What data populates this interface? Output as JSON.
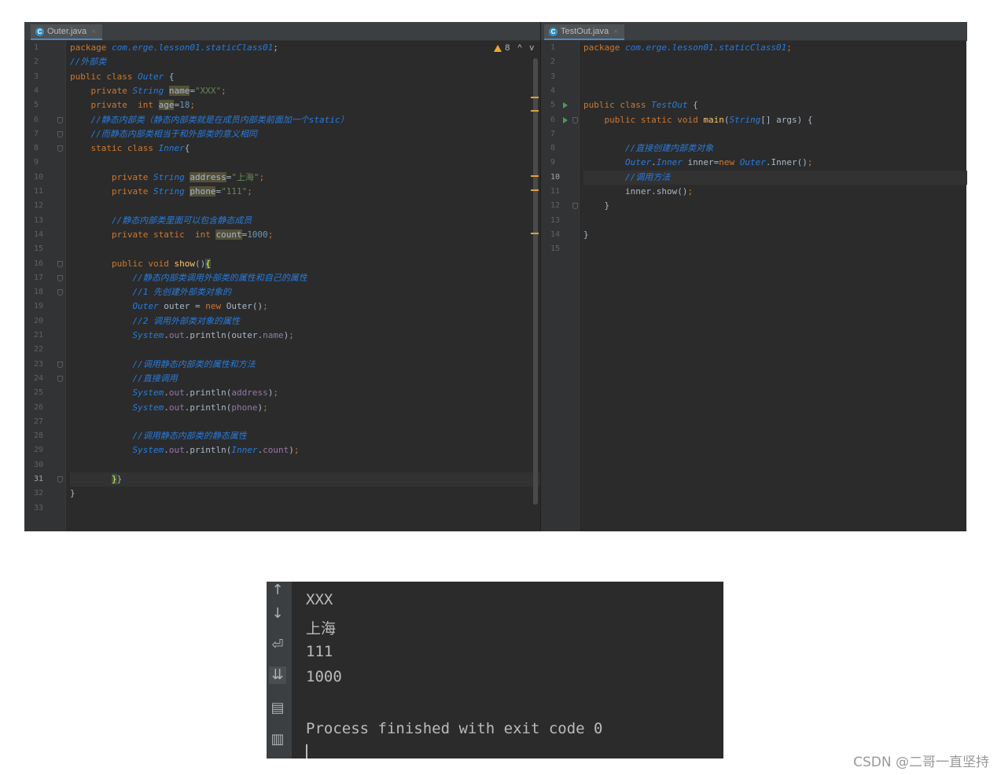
{
  "left_tab": {
    "label": "Outer.java",
    "close": "×"
  },
  "right_tab": {
    "label": "TestOut.java",
    "close": "×"
  },
  "inspection": {
    "count": "8",
    "up": "^",
    "down": "v"
  },
  "left_lines": [
    [
      [
        "kw",
        "package "
      ],
      [
        "ty",
        "com.erge.lesson01.staticClass01"
      ],
      [
        "",
        "; "
      ]
    ],
    [
      [
        "cm",
        "//外部类"
      ]
    ],
    [
      [
        "kw",
        "public class "
      ],
      [
        "cls",
        "Outer"
      ],
      [
        "",
        " {"
      ]
    ],
    [
      [
        "",
        "    "
      ],
      [
        "kw",
        "private "
      ],
      [
        "ty",
        "String "
      ],
      [
        "hl",
        "name"
      ],
      [
        "",
        "="
      ],
      [
        "str",
        "\"XXX\""
      ],
      [
        "kw",
        ";"
      ]
    ],
    [
      [
        "",
        "    "
      ],
      [
        "kw",
        "private  int "
      ],
      [
        "hl",
        "age"
      ],
      [
        "",
        "="
      ],
      [
        "num",
        "18"
      ],
      [
        "kw",
        ";"
      ]
    ],
    [
      [
        "",
        "    "
      ],
      [
        "cm",
        "//静态内部类（静态内部类就是在成员内部类前面加一个static）"
      ]
    ],
    [
      [
        "",
        "    "
      ],
      [
        "cm",
        "//而静态内部类相当于和外部类的意义相同"
      ]
    ],
    [
      [
        "",
        "    "
      ],
      [
        "kw",
        "static class "
      ],
      [
        "cls",
        "Inner"
      ],
      [
        "",
        "{"
      ]
    ],
    [
      [
        "",
        ""
      ]
    ],
    [
      [
        "",
        "        "
      ],
      [
        "kw",
        "private "
      ],
      [
        "ty",
        "String "
      ],
      [
        "hl",
        "address"
      ],
      [
        "",
        "="
      ],
      [
        "str",
        "\"上海\""
      ],
      [
        "kw",
        ";"
      ]
    ],
    [
      [
        "",
        "        "
      ],
      [
        "kw",
        "private "
      ],
      [
        "ty",
        "String "
      ],
      [
        "hl",
        "phone"
      ],
      [
        "",
        "="
      ],
      [
        "str",
        "\"111\""
      ],
      [
        "kw",
        ";"
      ]
    ],
    [
      [
        "",
        ""
      ]
    ],
    [
      [
        "",
        "        "
      ],
      [
        "cm",
        "//静态内部类里面可以包含静态成员"
      ]
    ],
    [
      [
        "",
        "        "
      ],
      [
        "kw",
        "private static  int "
      ],
      [
        "hl",
        "count"
      ],
      [
        "",
        "="
      ],
      [
        "num",
        "1000"
      ],
      [
        "kw",
        ";"
      ]
    ],
    [
      [
        "",
        ""
      ]
    ],
    [
      [
        "",
        "        "
      ],
      [
        "kw",
        "public void "
      ],
      [
        "fn",
        "show"
      ],
      [
        "",
        "()"
      ],
      [
        "brk",
        "{"
      ]
    ],
    [
      [
        "",
        "            "
      ],
      [
        "cm",
        "//静态内部类调用外部类的属性和自己的属性"
      ]
    ],
    [
      [
        "",
        "            "
      ],
      [
        "cm",
        "//1 先创建外部类对象的"
      ]
    ],
    [
      [
        "",
        "            "
      ],
      [
        "ty",
        "Outer "
      ],
      [
        "",
        "outer = "
      ],
      [
        "kw",
        "new "
      ],
      [
        "",
        "Outer()"
      ],
      [
        "kw",
        ";"
      ]
    ],
    [
      [
        "",
        "            "
      ],
      [
        "cm",
        "//2 调用外部类对象的属性"
      ]
    ],
    [
      [
        "",
        "            "
      ],
      [
        "ty",
        "System"
      ],
      [
        "",
        "."
      ],
      [
        "fld",
        "out"
      ],
      [
        "",
        ".println(outer."
      ],
      [
        "fld",
        "name"
      ],
      [
        "",
        ")"
      ],
      [
        "kw",
        ";"
      ]
    ],
    [
      [
        "",
        ""
      ]
    ],
    [
      [
        "",
        "            "
      ],
      [
        "cm",
        "//调用静态内部类的属性和方法"
      ]
    ],
    [
      [
        "",
        "            "
      ],
      [
        "cm",
        "//直接调用"
      ]
    ],
    [
      [
        "",
        "            "
      ],
      [
        "ty",
        "System"
      ],
      [
        "",
        "."
      ],
      [
        "fld",
        "out"
      ],
      [
        "",
        ".println("
      ],
      [
        "fld",
        "address"
      ],
      [
        "",
        ")"
      ],
      [
        "kw",
        ";"
      ]
    ],
    [
      [
        "",
        "            "
      ],
      [
        "ty",
        "System"
      ],
      [
        "",
        "."
      ],
      [
        "fld",
        "out"
      ],
      [
        "",
        ".println("
      ],
      [
        "fld",
        "phone"
      ],
      [
        "",
        ")"
      ],
      [
        "kw",
        ";"
      ]
    ],
    [
      [
        "",
        ""
      ]
    ],
    [
      [
        "",
        "            "
      ],
      [
        "cm",
        "//调用静态内部类的静态属性"
      ]
    ],
    [
      [
        "",
        "            "
      ],
      [
        "ty",
        "System"
      ],
      [
        "",
        "."
      ],
      [
        "fld",
        "out"
      ],
      [
        "",
        ".println("
      ],
      [
        "cls",
        "Inner"
      ],
      [
        "",
        "."
      ],
      [
        "fld",
        "count"
      ],
      [
        "",
        ")"
      ],
      [
        "kw",
        ";"
      ]
    ],
    [
      [
        "",
        ""
      ]
    ],
    [
      [
        "",
        "        "
      ],
      [
        "brk",
        "}"
      ],
      [
        "",
        "}"
      ]
    ],
    [
      [
        "",
        "}"
      ]
    ],
    [
      [
        "",
        ""
      ]
    ]
  ],
  "right_lines": [
    [
      [
        "kw",
        "package "
      ],
      [
        "ty",
        "com.erge.lesson01.staticClass01"
      ],
      [
        "kw",
        ";"
      ]
    ],
    [
      [
        "",
        ""
      ]
    ],
    [
      [
        "",
        ""
      ]
    ],
    [
      [
        "",
        ""
      ]
    ],
    [
      [
        "kw",
        "public class "
      ],
      [
        "cls",
        "TestOut"
      ],
      [
        "",
        " {"
      ]
    ],
    [
      [
        "",
        "    "
      ],
      [
        "kw",
        "public static void "
      ],
      [
        "fn",
        "main"
      ],
      [
        "",
        "("
      ],
      [
        "ty",
        "String"
      ],
      [
        "",
        "[] args) {"
      ]
    ],
    [
      [
        "",
        ""
      ]
    ],
    [
      [
        "",
        "        "
      ],
      [
        "cm",
        "//直接创建内部类对象"
      ]
    ],
    [
      [
        "",
        "        "
      ],
      [
        "ty",
        "Outer"
      ],
      [
        "",
        "."
      ],
      [
        "ty",
        "Inner "
      ],
      [
        "",
        "inner="
      ],
      [
        "kw",
        "new "
      ],
      [
        "ty",
        "Outer"
      ],
      [
        "",
        ".Inner()"
      ],
      [
        "kw",
        ";"
      ]
    ],
    [
      [
        "",
        "        "
      ],
      [
        "cm",
        "//调用方法"
      ]
    ],
    [
      [
        "",
        "        "
      ],
      [
        "",
        "inner.show()"
      ],
      [
        "kw",
        ";"
      ]
    ],
    [
      [
        "",
        "    "
      ],
      [
        "",
        "}"
      ]
    ],
    [
      [
        "",
        ""
      ]
    ],
    [
      [
        "",
        "}"
      ]
    ],
    [
      [
        "",
        ""
      ]
    ]
  ],
  "left_line_numbers": [
    "1",
    "2",
    "3",
    "4",
    "5",
    "6",
    "7",
    "8",
    "9",
    "10",
    "11",
    "12",
    "13",
    "14",
    "15",
    "16",
    "17",
    "18",
    "19",
    "20",
    "21",
    "22",
    "23",
    "24",
    "25",
    "26",
    "27",
    "28",
    "29",
    "30",
    "31",
    "32",
    "33"
  ],
  "right_line_numbers": [
    "1",
    "2",
    "3",
    "4",
    "5",
    "6",
    "7",
    "8",
    "9",
    "10",
    "11",
    "12",
    "13",
    "14",
    "15"
  ],
  "console": {
    "output": [
      "XXX",
      "上海",
      "111",
      "1000",
      "",
      "Process finished with exit code 0"
    ]
  },
  "watermark": "CSDN @二哥一直坚持",
  "colors": {
    "keyword": "#cc7832",
    "type": "#287bde",
    "string": "#6a8759",
    "number": "#6897bb",
    "field": "#9876aa",
    "background": "#2b2b2b"
  }
}
